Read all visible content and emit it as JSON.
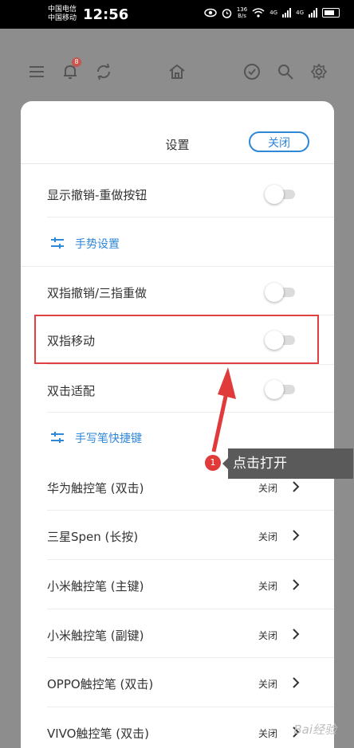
{
  "status_bar": {
    "carrier1": "中国电信",
    "carrier2": "中国移动",
    "time": "12:56",
    "speed_value": "136",
    "speed_unit": "B/s",
    "net_label": "4G"
  },
  "toolbar": {
    "notification_count": "8",
    "icons": [
      "menu-icon",
      "bell-icon",
      "sync-icon",
      "home-icon",
      "check-circle-icon",
      "search-icon",
      "gear-icon"
    ]
  },
  "sheet": {
    "title": "设置",
    "close_label": "关闭",
    "rows": [
      {
        "label": "显示撤销-重做按钮",
        "toggle_on": false
      },
      {
        "label": "双指撤销/三指重做",
        "toggle_on": false
      },
      {
        "label": "双指移动",
        "toggle_on": false
      },
      {
        "label": "双击适配",
        "toggle_on": false
      }
    ],
    "sections": [
      {
        "label": "手势设置",
        "icon": "sliders-icon"
      },
      {
        "label": "手写笔快捷键",
        "icon": "sliders-icon"
      }
    ],
    "pens": [
      {
        "label": "华为触控笔 (双击)",
        "value": "关闭"
      },
      {
        "label": "三星Spen (长按)",
        "value": "关闭"
      },
      {
        "label": "小米触控笔 (主键)",
        "value": "关闭"
      },
      {
        "label": "小米触控笔 (副键)",
        "value": "关闭"
      },
      {
        "label": "OPPO触控笔 (双击)",
        "value": "关闭"
      },
      {
        "label": "VIVO触控笔 (双击)",
        "value": "关闭"
      }
    ]
  },
  "annotation": {
    "step_number": "1",
    "callout_text": "点击打开",
    "highlight_color": "#e04040"
  },
  "watermark": "Bai经验",
  "colors": {
    "accent": "#2f87d8",
    "overlay": "#8d8d8d"
  }
}
